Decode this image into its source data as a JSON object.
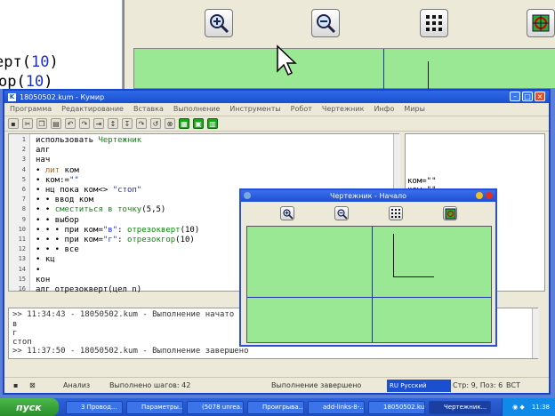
{
  "bg_code": {
    "line1_text": "ерт",
    "line1_num": "10",
    "line2_text": "ор",
    "line2_num": "10"
  },
  "main": {
    "title": "18050502.kum - Кумир",
    "menu": [
      "Программа",
      "Редактирование",
      "Вставка",
      "Выполнение",
      "Инструменты",
      "Робот",
      "Чертежник",
      "Инфо",
      "Миры"
    ],
    "code_lines": [
      {
        "n": "1",
        "segments": [
          [
            "kw",
            "использовать "
          ],
          [
            "green",
            "Чертежник"
          ]
        ]
      },
      {
        "n": "2",
        "segments": [
          [
            "kw",
            "алг"
          ]
        ]
      },
      {
        "n": "3",
        "segments": [
          [
            "kw",
            "нач"
          ]
        ]
      },
      {
        "n": "4",
        "segments": [
          [
            "kw",
            "• "
          ],
          [
            "orange",
            "лит"
          ],
          [
            "kw",
            " ком"
          ]
        ]
      },
      {
        "n": "5",
        "segments": [
          [
            "kw",
            "• ком:="
          ],
          [
            "blue",
            "\"\""
          ]
        ]
      },
      {
        "n": "6",
        "segments": [
          [
            "kw",
            "• нц пока ком<> "
          ],
          [
            "blue",
            "\"стоп\""
          ]
        ]
      },
      {
        "n": "7",
        "segments": [
          [
            "kw",
            "• • ввод ком"
          ]
        ]
      },
      {
        "n": "8",
        "segments": [
          [
            "kw",
            "• • "
          ],
          [
            "green",
            "сместиться в точку"
          ],
          [
            "kw",
            "(5,5)"
          ]
        ]
      },
      {
        "n": "9",
        "segments": [
          [
            "kw",
            "• • выбор"
          ]
        ]
      },
      {
        "n": "10",
        "segments": [
          [
            "kw",
            "• • • при ком="
          ],
          [
            "blue",
            "\"в\""
          ],
          [
            "kw",
            ": "
          ],
          [
            "green",
            "отрезокверт"
          ],
          [
            "kw",
            "(10)"
          ]
        ]
      },
      {
        "n": "11",
        "segments": [
          [
            "kw",
            "• • • при ком="
          ],
          [
            "blue",
            "\"г\""
          ],
          [
            "kw",
            ": "
          ],
          [
            "green",
            "отрезокгор"
          ],
          [
            "kw",
            "(10)"
          ]
        ]
      },
      {
        "n": "12",
        "segments": [
          [
            "kw",
            "• • • все"
          ]
        ]
      },
      {
        "n": "13",
        "segments": [
          [
            "kw",
            "• кц"
          ]
        ]
      },
      {
        "n": "14",
        "segments": [
          [
            "kw",
            "• "
          ]
        ]
      },
      {
        "n": "15",
        "segments": [
          [
            "kw",
            "кон"
          ]
        ]
      },
      {
        "n": "16",
        "segments": [
          [
            "kw",
            "алг отрезокверт(цел n)"
          ]
        ]
      }
    ],
    "right_pane": {
      "line1": "ком=\"\"",
      "line2": "ком=\"\""
    },
    "output_lines": [
      ">> 11:34:43 - 18050502.kum - Выполнение начато",
      "в",
      "г",
      "стоп",
      ">> 11:37:50 - 18050502.kum - Выполнение завершено"
    ],
    "status": {
      "mode": "Анализ",
      "steps": "Выполнено шагов: 42",
      "state": "Выполнение завершено",
      "lang": "RU Русский",
      "pos": "Стр: 9, Поз: 6",
      "ins": "ВСТ"
    }
  },
  "chertezhnik": {
    "title": "Чертежник - Начало"
  },
  "taskbar": {
    "start": "пуск",
    "tasks": [
      "3 Провод...",
      "Параметры...",
      "(5078 unrea...",
      "Проигрыва...",
      "add-links-8-...",
      "18050502.kum",
      "Чертежник..."
    ],
    "clock": "11:38"
  }
}
